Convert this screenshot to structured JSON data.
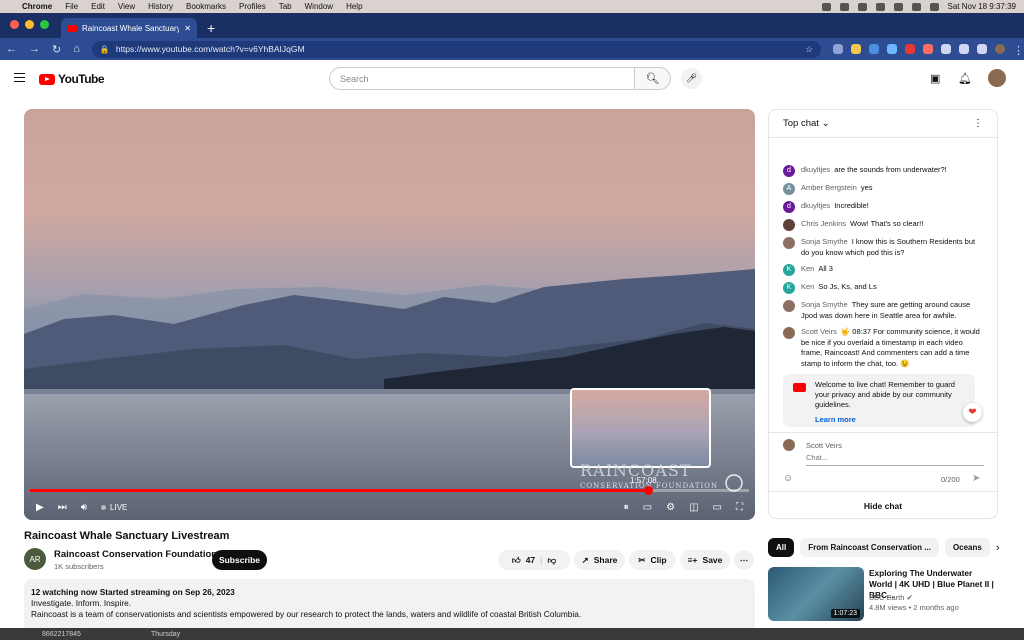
{
  "menubar": {
    "app": "Chrome",
    "items": [
      "File",
      "Edit",
      "View",
      "History",
      "Bookmarks",
      "Profiles",
      "Tab",
      "Window",
      "Help"
    ],
    "clock": "Sat Nov 18  9:37:39"
  },
  "browser": {
    "tab_title": "Raincoast Whale Sanctuary Li",
    "url": "https://www.youtube.com/watch?v=v6YhBAIJqGM",
    "colors": {
      "frame": "#1a2f64",
      "toolbar": "#2d4c92"
    }
  },
  "youtube": {
    "logo": "YouTube",
    "search_placeholder": "Search"
  },
  "video": {
    "title": "Raincoast Whale Sanctuary Livestream",
    "live_label": "LIVE",
    "preview_time": "1:57:08",
    "progress_fraction": 0.86,
    "watermark_line1": "RAINCOAST",
    "watermark_line2": "CONSERVATION FOUNDATION"
  },
  "channel": {
    "initials": "AR",
    "name": "Raincoast Conservation Foundation",
    "subscribers": "1K subscribers",
    "subscribe_label": "Subscribe"
  },
  "actions": {
    "likes": "47",
    "share": "Share",
    "clip": "Clip",
    "save": "Save"
  },
  "description": {
    "meta": "12 watching now  Started streaming on Sep 26, 2023",
    "line1": "Investigate. Inform. Inspire.",
    "line2": "Raincoast is a team of conservationists and scientists empowered by our research to protect the lands, waters and wildlife of coastal British Columbia."
  },
  "chat": {
    "header": "Top chat",
    "messages": [
      {
        "author": "dkuyltjes",
        "text": "are the sounds from underwater?!",
        "initial": "d",
        "color": "#6a1b9a"
      },
      {
        "author": "Amber Bergstein",
        "text": "yes",
        "initial": "A",
        "color": "#78909c"
      },
      {
        "author": "dkuyltjes",
        "text": "Incredible!",
        "initial": "d",
        "color": "#6a1b9a"
      },
      {
        "author": "Chris Jenkins",
        "text": "Wow! That's so clear!!",
        "initial": "",
        "color": "#5d4037"
      },
      {
        "author": "Sonja Smythe",
        "text": "I know this is Southern Residents but do you know which pod this is?",
        "initial": "",
        "color": "#8d6e63"
      },
      {
        "author": "Ken",
        "text": "All 3",
        "initial": "K",
        "color": "#26a69a"
      },
      {
        "author": "Ken",
        "text": "So Js, Ks, and Ls",
        "initial": "K",
        "color": "#26a69a"
      },
      {
        "author": "Sonja Smythe",
        "text": "They sure are getting around cause Jpod was down here in Seattle area for awhile.",
        "initial": "",
        "color": "#8d6e63"
      },
      {
        "author": "Scott Veirs",
        "text": "🤟 08:37 For community science, it would be nice if you overlaid a timestamp in each video frame, Raincoast! And commenters can add a time stamp to inform the chat, too. 😉",
        "initial": "",
        "color": "#8a6a52"
      }
    ],
    "notice": "Welcome to live chat! Remember to guard your privacy and abide by our community guidelines.",
    "learn_more": "Learn more",
    "current_user": "Scott Veirs",
    "input_placeholder": "Chat...",
    "char_count": "0/200",
    "hide_label": "Hide chat"
  },
  "recommendations": {
    "chips": [
      "All",
      "From Raincoast Conservation ...",
      "Oceans"
    ],
    "items": [
      {
        "title": "Exploring The Underwater World | 4K UHD | Blue Planet II | BBC...",
        "channel": "BBC Earth ✔",
        "meta": "4.8M views • 2 months ago",
        "duration": "1:07:23"
      }
    ]
  },
  "dock": {
    "number": "8662217845",
    "day": "Thursday"
  }
}
